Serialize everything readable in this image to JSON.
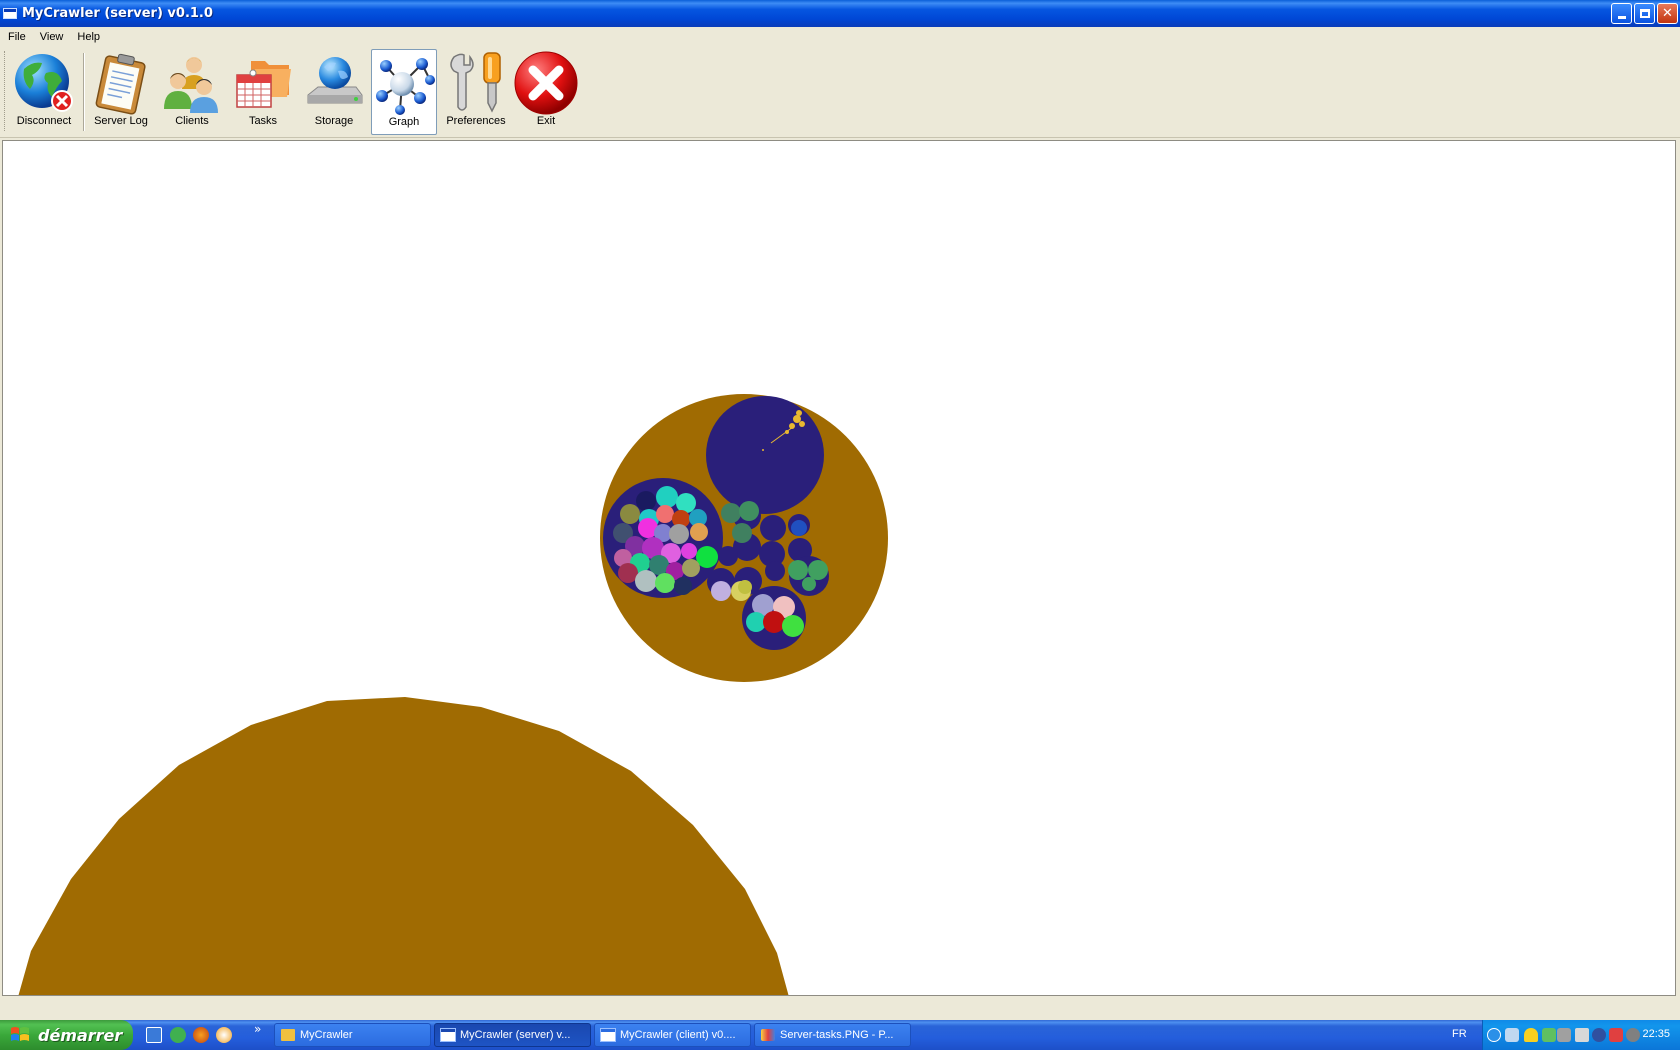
{
  "window": {
    "title": "MyCrawler (server) v0.1.0"
  },
  "menu": [
    "File",
    "View",
    "Help"
  ],
  "toolbar": {
    "buttons": [
      {
        "label": "Disconnect",
        "icon": "globe-disconnect-icon"
      },
      {
        "label": "Server Log",
        "icon": "clipboard-icon"
      },
      {
        "label": "Clients",
        "icon": "users-icon"
      },
      {
        "label": "Tasks",
        "icon": "calendar-folder-icon"
      },
      {
        "label": "Storage",
        "icon": "globe-drive-icon"
      },
      {
        "label": "Graph",
        "icon": "molecule-graph-icon",
        "active": true
      },
      {
        "label": "Preferences",
        "icon": "tools-icon"
      },
      {
        "label": "Exit",
        "icon": "exit-icon"
      }
    ]
  },
  "graph": {
    "colors": {
      "outer": "#a06b02",
      "cluster": "#2a1f7a",
      "seed": "#e8b830"
    }
  },
  "taskbar": {
    "start_label": "démarrer",
    "quick_launch_more": "»",
    "tasks": [
      {
        "label": "MyCrawler",
        "icon": "folder-icon",
        "active": false
      },
      {
        "label": "MyCrawler (server) v...",
        "icon": "window-icon",
        "active": true
      },
      {
        "label": "MyCrawler (client) v0....",
        "icon": "window-icon",
        "active": false
      },
      {
        "label": "Server-tasks.PNG - P...",
        "icon": "paint-icon",
        "active": false
      }
    ],
    "tray": {
      "language": "FR",
      "clock": "22:35"
    }
  }
}
